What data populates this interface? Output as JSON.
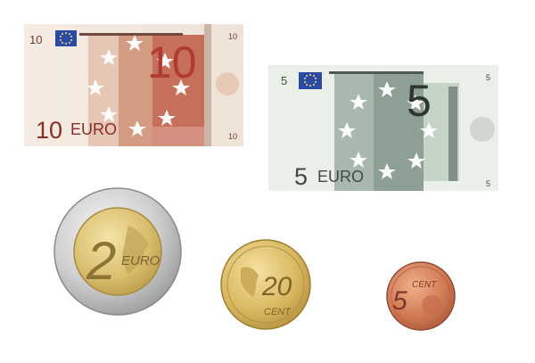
{
  "notes": [
    {
      "denomination": "10",
      "corner_top_left": "10",
      "corner_top_right": "10",
      "corner_bottom_right": "10",
      "big_numeral": "10",
      "caption_number": "10",
      "caption_currency": "EURO",
      "colors": {
        "base": "#f1e6dc",
        "accent": "#c9735c",
        "deep": "#b84a3d",
        "text": "#8a2d25"
      }
    },
    {
      "denomination": "5",
      "corner_top_left": "5",
      "corner_top_right": "5",
      "corner_bottom_right": "5",
      "big_numeral": "5",
      "caption_number": "5",
      "caption_currency": "EURO",
      "colors": {
        "base": "#e9eee6",
        "accent": "#95a699",
        "deep": "#6e7f73",
        "text": "#3f4a43"
      }
    }
  ],
  "coins": [
    {
      "value": "2",
      "currency": "EURO",
      "type": "bimetallic"
    },
    {
      "value": "20",
      "currency": "CENT",
      "type": "gold"
    },
    {
      "value": "5",
      "currency": "CENT",
      "type": "copper"
    }
  ],
  "icons": {
    "flag": "eu-flag-icon",
    "star": "star-icon"
  }
}
